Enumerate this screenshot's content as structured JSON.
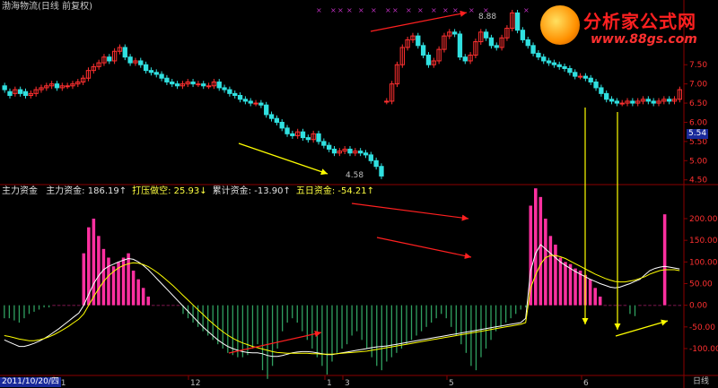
{
  "header": {
    "title": "渤海物流(日线 前复权)"
  },
  "indicator": {
    "name": "主力资金",
    "items": [
      {
        "label": "主力资金:",
        "value": "186.19",
        "arrow": "↑",
        "color": "#e0e0e0"
      },
      {
        "label": "打压做空:",
        "value": "25.93",
        "arrow": "↓",
        "color": "#ffff40"
      },
      {
        "label": "累计资金:",
        "value": "-13.90",
        "arrow": "↑",
        "color": "#e0e0e0"
      },
      {
        "label": "五日资金:",
        "value": "-54.21",
        "arrow": "↑",
        "color": "#ffff40"
      }
    ]
  },
  "logo": {
    "brand": "分析家公式网",
    "url": "www.88gs.com"
  },
  "x_axis": {
    "date_label": "2011/10/20/四",
    "month_ticks": [
      "11",
      "12",
      "1",
      "3",
      "5",
      "6"
    ],
    "period_label": "日线"
  },
  "colors": {
    "up": "#ff3030",
    "down": "#30e0e0",
    "pos_bar": "#ff30a0",
    "neg_bar": "#30a060",
    "grid": "#8b0000",
    "line1": "#ffffff",
    "line2": "#ffff00",
    "arrow_red": "#ff2020",
    "arrow_yellow": "#ffff00"
  },
  "chart_data": [
    {
      "type": "candlestick",
      "title": "渤海物流(日线 前复权)",
      "ylim": [
        4.4,
        9.0
      ],
      "y_ticks": [
        "7.50",
        "7.00",
        "6.50",
        "6.00",
        "5.50",
        "5.00",
        "4.50"
      ],
      "last_price": "5.54",
      "annotations": [
        "8.88",
        "4.58"
      ],
      "close": [
        6.85,
        6.7,
        6.85,
        6.75,
        6.7,
        6.75,
        6.85,
        6.9,
        6.95,
        7.0,
        6.9,
        6.95,
        6.95,
        7.0,
        7.05,
        7.15,
        7.35,
        7.45,
        7.55,
        7.7,
        7.6,
        7.85,
        7.95,
        7.7,
        7.55,
        7.6,
        7.5,
        7.35,
        7.3,
        7.25,
        7.15,
        7.05,
        7.0,
        6.95,
        7.0,
        7.05,
        7.0,
        7.0,
        6.95,
        6.95,
        7.05,
        6.9,
        6.85,
        6.75,
        6.7,
        6.6,
        6.55,
        6.5,
        6.5,
        6.45,
        6.2,
        6.1,
        6.0,
        5.85,
        5.7,
        5.65,
        5.75,
        5.6,
        5.55,
        5.7,
        5.5,
        5.4,
        5.3,
        5.2,
        5.25,
        5.3,
        5.2,
        5.25,
        5.2,
        5.15,
        5.0,
        4.85,
        4.6,
        6.55,
        7.0,
        7.5,
        7.95,
        8.15,
        8.25,
        8.0,
        7.75,
        7.5,
        7.6,
        7.9,
        8.25,
        8.35,
        8.3,
        7.7,
        7.6,
        7.75,
        8.1,
        8.35,
        8.2,
        8.0,
        7.95,
        8.2,
        8.45,
        8.85,
        8.4,
        8.15,
        8.0,
        7.8,
        7.7,
        7.6,
        7.55,
        7.5,
        7.45,
        7.4,
        7.3,
        7.2,
        7.2,
        7.15,
        7.05,
        6.9,
        6.75,
        6.6,
        6.55,
        6.5,
        6.5,
        6.55,
        6.5,
        6.55,
        6.6,
        6.55,
        6.5,
        6.55,
        6.6,
        6.55,
        6.6,
        6.85
      ],
      "open": [
        6.95,
        6.8,
        6.75,
        6.85,
        6.8,
        6.7,
        6.75,
        6.85,
        6.9,
        6.95,
        7.0,
        6.9,
        6.95,
        6.95,
        7.0,
        7.05,
        7.15,
        7.35,
        7.45,
        7.55,
        7.7,
        7.6,
        7.85,
        7.95,
        7.7,
        7.55,
        7.6,
        7.5,
        7.35,
        7.3,
        7.25,
        7.15,
        7.05,
        7.0,
        6.95,
        7.0,
        7.05,
        7.0,
        7.0,
        6.95,
        6.95,
        7.05,
        6.9,
        6.85,
        6.75,
        6.7,
        6.6,
        6.55,
        6.5,
        6.5,
        6.45,
        6.2,
        6.1,
        6.0,
        5.85,
        5.7,
        5.65,
        5.75,
        5.6,
        5.55,
        5.7,
        5.5,
        5.4,
        5.3,
        5.2,
        5.25,
        5.3,
        5.2,
        5.25,
        5.2,
        5.15,
        5.0,
        4.85,
        6.55,
        6.55,
        7.0,
        7.5,
        7.95,
        8.15,
        8.25,
        8.0,
        7.75,
        7.5,
        7.6,
        7.9,
        8.25,
        8.35,
        8.3,
        7.7,
        7.6,
        7.75,
        8.1,
        8.35,
        8.2,
        8.0,
        7.95,
        8.2,
        8.45,
        8.85,
        8.4,
        8.15,
        8.0,
        7.8,
        7.7,
        7.6,
        7.55,
        7.5,
        7.45,
        7.4,
        7.3,
        7.2,
        7.2,
        7.15,
        7.05,
        6.9,
        6.75,
        6.6,
        6.55,
        6.5,
        6.5,
        6.55,
        6.5,
        6.55,
        6.6,
        6.55,
        6.5,
        6.55,
        6.6,
        6.55,
        6.6
      ]
    },
    {
      "type": "bar",
      "title": "主力资金",
      "ylim": [
        -160,
        260
      ],
      "y_ticks": [
        "200.00",
        "150.00",
        "100.00",
        "50.00",
        "0.00",
        "-50.00",
        "-100.00"
      ],
      "values": [
        -30,
        -30,
        -35,
        -40,
        -30,
        -20,
        -15,
        -10,
        -5,
        -5,
        0,
        0,
        0,
        0,
        0,
        0,
        120,
        180,
        200,
        160,
        130,
        110,
        90,
        100,
        110,
        120,
        80,
        60,
        40,
        20,
        0,
        0,
        0,
        0,
        0,
        0,
        -20,
        -30,
        -40,
        -50,
        -60,
        -70,
        -80,
        -90,
        -100,
        -110,
        -115,
        -120,
        -120,
        -115,
        -100,
        -90,
        -150,
        -170,
        -140,
        -100,
        -60,
        -40,
        -30,
        -40,
        -60,
        -80,
        -100,
        -120,
        -140,
        -160,
        -130,
        -110,
        -100,
        -90,
        -70,
        -60,
        -80,
        -100,
        -120,
        -140,
        -150,
        -130,
        -120,
        -110,
        -100,
        -90,
        -80,
        -70,
        -60,
        -50,
        -40,
        -30,
        -20,
        -30,
        -50,
        -70,
        -90,
        -110,
        -140,
        -150,
        -120,
        -100,
        -80,
        -60,
        -50,
        -40,
        -30,
        -20,
        -10,
        -5,
        230,
        270,
        250,
        200,
        160,
        140,
        110,
        100,
        95,
        85,
        80,
        70,
        60,
        40,
        20,
        0,
        0,
        0,
        0,
        0,
        -20,
        -25,
        0,
        0,
        0,
        0,
        0,
        210,
        0,
        0,
        0
      ],
      "line1": [
        -80,
        -85,
        -90,
        -95,
        -95,
        -92,
        -88,
        -83,
        -77,
        -70,
        -62,
        -54,
        -45,
        -36,
        -27,
        -18,
        0,
        25,
        50,
        68,
        82,
        90,
        95,
        100,
        104,
        108,
        106,
        100,
        92,
        82,
        70,
        58,
        46,
        34,
        22,
        10,
        -2,
        -14,
        -26,
        -38,
        -50,
        -60,
        -70,
        -80,
        -88,
        -95,
        -100,
        -104,
        -107,
        -109,
        -110,
        -110,
        -112,
        -116,
        -118,
        -118,
        -116,
        -113,
        -110,
        -108,
        -107,
        -107,
        -108,
        -110,
        -112,
        -114,
        -114,
        -112,
        -110,
        -108,
        -106,
        -104,
        -102,
        -100,
        -98,
        -96,
        -95,
        -94,
        -92,
        -90,
        -88,
        -86,
        -84,
        -82,
        -80,
        -78,
        -76,
        -74,
        -72,
        -70,
        -68,
        -66,
        -64,
        -62,
        -60,
        -58,
        -56,
        -54,
        -52,
        -50,
        -48,
        -46,
        -44,
        -42,
        -40,
        -30,
        80,
        120,
        140,
        130,
        120,
        110,
        100,
        92,
        85,
        78,
        72,
        66,
        60,
        55,
        50,
        46,
        42,
        40,
        42,
        46,
        50,
        55,
        60,
        70,
        80,
        85,
        88,
        90,
        88,
        86,
        84
      ],
      "line2": [
        -70,
        -72,
        -75,
        -78,
        -80,
        -82,
        -82,
        -80,
        -77,
        -73,
        -68,
        -62,
        -55,
        -48,
        -40,
        -32,
        -20,
        0,
        20,
        38,
        55,
        68,
        78,
        86,
        92,
        96,
        98,
        97,
        94,
        89,
        82,
        74,
        65,
        55,
        45,
        34,
        23,
        12,
        1,
        -10,
        -21,
        -32,
        -42,
        -52,
        -61,
        -69,
        -76,
        -82,
        -87,
        -91,
        -95,
        -98,
        -101,
        -104,
        -107,
        -109,
        -110,
        -111,
        -111,
        -111,
        -111,
        -111,
        -112,
        -112,
        -113,
        -113,
        -113,
        -112,
        -111,
        -110,
        -109,
        -108,
        -107,
        -106,
        -104,
        -102,
        -100,
        -98,
        -96,
        -94,
        -92,
        -90,
        -88,
        -86,
        -84,
        -82,
        -80,
        -78,
        -76,
        -74,
        -72,
        -70,
        -68,
        -66,
        -64,
        -62,
        -60,
        -58,
        -56,
        -54,
        -52,
        -50,
        -48,
        -46,
        -44,
        -40,
        40,
        70,
        95,
        110,
        115,
        115,
        112,
        108,
        102,
        96,
        90,
        84,
        78,
        72,
        67,
        62,
        58,
        55,
        54,
        54,
        56,
        58,
        62,
        66,
        72,
        76,
        80,
        82,
        82,
        82,
        80
      ]
    }
  ]
}
